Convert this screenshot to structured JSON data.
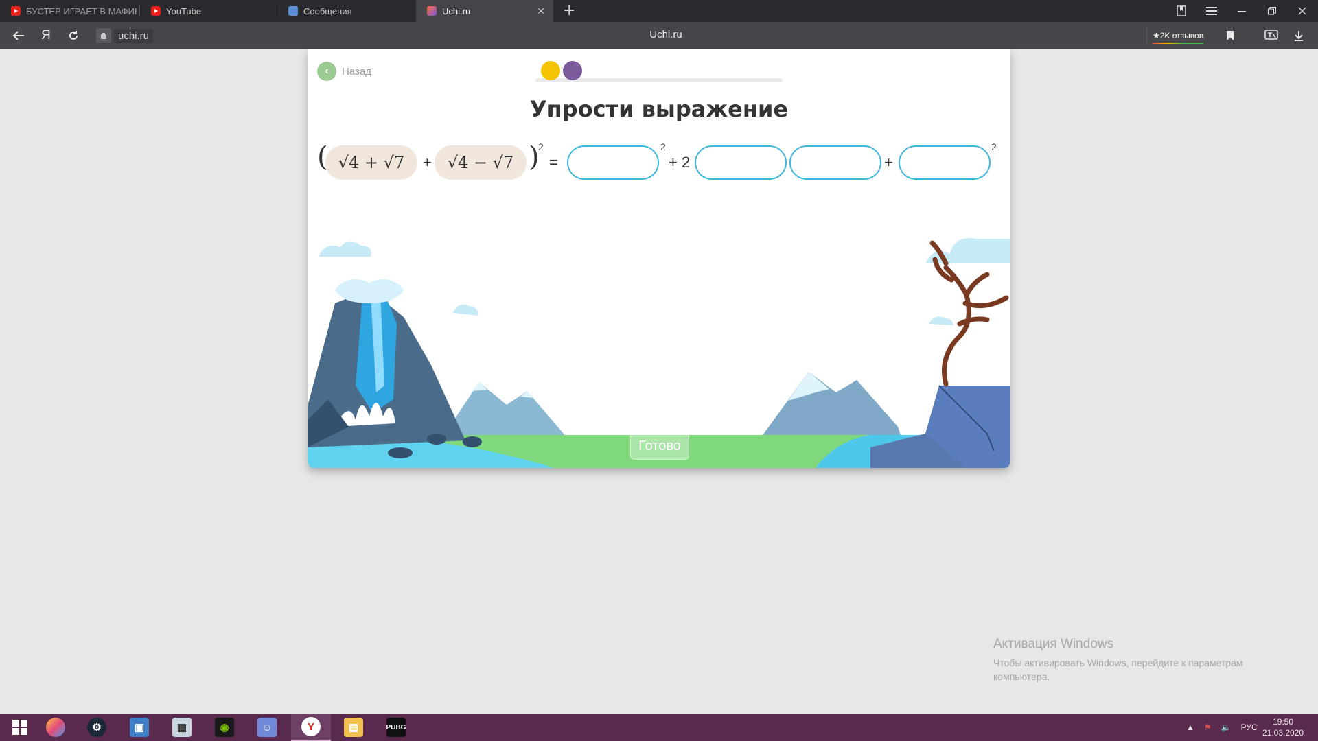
{
  "browser": {
    "tabs": [
      {
        "label": "БУСТЕР ИГРАЕТ В МАФИЮ",
        "favicon": "youtube-icon"
      },
      {
        "label": "YouTube",
        "favicon": "youtube-icon"
      },
      {
        "label": "Сообщения",
        "favicon": "messages-icon"
      },
      {
        "label": "Uchi.ru",
        "favicon": "uchi-icon",
        "active": true
      }
    ],
    "address": "uchi.ru",
    "page_title": "Uchi.ru",
    "reviews": "★2K отзывов"
  },
  "page": {
    "back_label": "Назад",
    "title": "Упрости выражение",
    "progress_dots": [
      {
        "color": "#f5c400",
        "state": "done"
      },
      {
        "color": "#7a5a9a",
        "state": "current"
      }
    ],
    "expression": {
      "open_paren": "(",
      "close_paren": ")",
      "term1": "√4 + √7",
      "op1": "+",
      "term2": "√4 − √7",
      "exponent": "2",
      "equals": "=",
      "exponent_after_first_box": "2",
      "plus_two": "+ 2",
      "plus": "+",
      "exponent_last": "2"
    },
    "answer_boxes": [
      {
        "value": ""
      },
      {
        "value": ""
      },
      {
        "value": ""
      },
      {
        "value": ""
      }
    ],
    "done_button": "Готово",
    "accent_color": "#3fb7dc"
  },
  "activation": {
    "title": "Активация Windows",
    "subtitle": "Чтобы активировать Windows, перейдите к параметрам компьютера."
  },
  "taskbar": {
    "apps": [
      "windows-start-icon",
      "paint-icon",
      "steam-icon",
      "explorer-icon",
      "calculator-icon",
      "nvidia-icon",
      "discord-icon",
      "yandex-browser-icon",
      "files-icon",
      "pubg-icon"
    ],
    "language": "РУС",
    "time": "19:50",
    "date": "21.03.2020"
  }
}
